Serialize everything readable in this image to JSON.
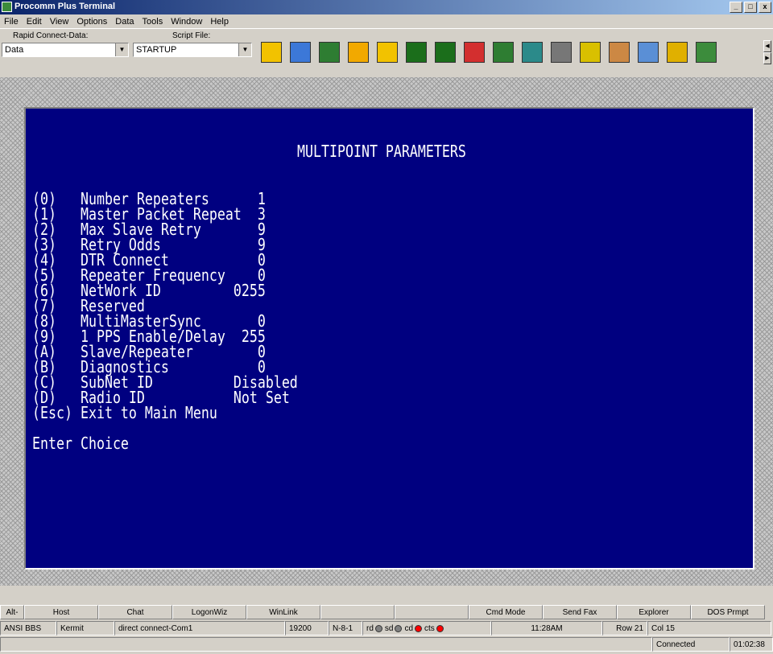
{
  "window": {
    "title": "Procomm Plus Terminal"
  },
  "menu": [
    "File",
    "Edit",
    "View",
    "Options",
    "Data",
    "Tools",
    "Window",
    "Help"
  ],
  "toolbar": {
    "rapid_connect_label": "Rapid Connect-Data:",
    "rapid_connect_value": "Data",
    "script_file_label": "Script File:",
    "script_file_value": "STARTUP",
    "icons": [
      "runner-icon",
      "book-icon",
      "mode-icon",
      "upload-icon",
      "download-icon",
      "network-icon",
      "network2-icon",
      "phone-icon",
      "monitor-icon",
      "clip-icon",
      "filter-icon",
      "sieve-icon",
      "tools-icon",
      "keyboard-icon",
      "cable-icon",
      "settings-icon"
    ]
  },
  "terminal": {
    "header": "MULTIPOINT PARAMETERS",
    "lines": [
      "(0)   Number Repeaters      1",
      "(1)   Master Packet Repeat  3",
      "(2)   Max Slave Retry       9",
      "(3)   Retry Odds            9",
      "(4)   DTR Connect           0",
      "(5)   Repeater Frequency    0",
      "(6)   NetWork ID         0255",
      "(7)   Reserved",
      "(8)   MultiMasterSync       0",
      "(9)   1 PPS Enable/Delay  255",
      "(A)   Slave/Repeater        0",
      "(B)   Diagnostics           0",
      "(C)   SubNet ID          Disabled",
      "(D)   Radio ID           Not Set",
      "(Esc) Exit to Main Menu",
      "",
      "Enter Choice"
    ]
  },
  "actionbar": [
    "Alt-",
    "Host",
    "Chat",
    "LogonWiz",
    "WinLink",
    "",
    "",
    "Cmd Mode",
    "Send Fax",
    "Explorer",
    "DOS Prmpt"
  ],
  "statusbar": {
    "emulation": "ANSI BBS",
    "protocol": "Kermit",
    "connection": "direct connect-Com1",
    "baud": "19200",
    "format": "N-8-1",
    "leds": [
      "rd",
      "sd",
      "cd",
      "cts"
    ],
    "time": "11:28AM",
    "row": "Row 21",
    "col": "Col 15",
    "connected": "Connected",
    "elapsed": "01:02:38"
  },
  "colors": {
    "terminal_bg": "#000080",
    "terminal_fg": "#ffffff",
    "led_off": "#808080",
    "led_on": "#ff0000"
  }
}
